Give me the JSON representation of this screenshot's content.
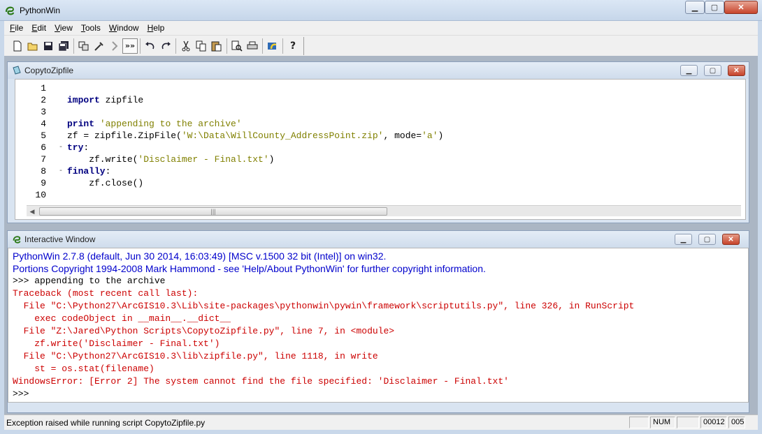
{
  "window": {
    "title": "PythonWin",
    "min_label": "▁",
    "max_label": "▢",
    "close_label": "✕"
  },
  "menu": [
    "File",
    "Edit",
    "View",
    "Tools",
    "Window",
    "Help"
  ],
  "editor": {
    "title": "CopytoZipfile",
    "scroll_thumb": "|||",
    "lines": [
      {
        "num": "1",
        "fold": "",
        "html": ""
      },
      {
        "num": "2",
        "fold": "",
        "parts": [
          [
            "kw",
            "import"
          ],
          [
            "",
            " zipfile"
          ]
        ]
      },
      {
        "num": "3",
        "fold": "",
        "parts": []
      },
      {
        "num": "4",
        "fold": "",
        "parts": [
          [
            "kw",
            "print"
          ],
          [
            "",
            " "
          ],
          [
            "str",
            "'appending to the archive'"
          ]
        ]
      },
      {
        "num": "5",
        "fold": "",
        "parts": [
          [
            "",
            "zf = zipfile.ZipFile("
          ],
          [
            "str",
            "'W:\\Data\\WillCounty_AddressPoint.zip'"
          ],
          [
            "",
            ", mode="
          ],
          [
            "str",
            "'a'"
          ],
          [
            "",
            ")"
          ]
        ]
      },
      {
        "num": "6",
        "fold": "-",
        "parts": [
          [
            "kw",
            "try"
          ],
          [
            "",
            ":"
          ]
        ]
      },
      {
        "num": "7",
        "fold": "",
        "parts": [
          [
            "",
            "    zf.write("
          ],
          [
            "str",
            "'Disclaimer - Final.txt'"
          ],
          [
            "",
            ")"
          ]
        ]
      },
      {
        "num": "8",
        "fold": "-",
        "parts": [
          [
            "kw",
            "finally"
          ],
          [
            "",
            ":"
          ]
        ]
      },
      {
        "num": "9",
        "fold": "",
        "parts": [
          [
            "",
            "    zf.close()"
          ]
        ]
      },
      {
        "num": "10",
        "fold": "",
        "parts": []
      }
    ]
  },
  "interactive": {
    "title": "Interactive Window",
    "banner": [
      "PythonWin 2.7.8 (default, Jun 30 2014, 16:03:49) [MSC v.1500 32 bit (Intel)] on win32.",
      "Portions Copyright 1994-2008 Mark Hammond - see 'Help/About PythonWin' for further copyright information."
    ],
    "output": [
      {
        "color": "black",
        "text": ">>> appending to the archive"
      },
      {
        "color": "red",
        "text": "Traceback (most recent call last):"
      },
      {
        "color": "red",
        "text": "  File \"C:\\Python27\\ArcGIS10.3\\Lib\\site-packages\\pythonwin\\pywin\\framework\\scriptutils.py\", line 326, in RunScript"
      },
      {
        "color": "red",
        "text": "    exec codeObject in __main__.__dict__"
      },
      {
        "color": "red",
        "text": "  File \"Z:\\Jared\\Python Scripts\\CopytoZipfile.py\", line 7, in <module>"
      },
      {
        "color": "red",
        "text": "    zf.write('Disclaimer - Final.txt')"
      },
      {
        "color": "red",
        "text": "  File \"C:\\Python27\\ArcGIS10.3\\lib\\zipfile.py\", line 1118, in write"
      },
      {
        "color": "red",
        "text": "    st = os.stat(filename)"
      },
      {
        "color": "red",
        "text": "WindowsError: [Error 2] The system cannot find the file specified: 'Disclaimer - Final.txt'"
      },
      {
        "color": "black",
        "text": ">>>"
      }
    ]
  },
  "status": {
    "message": "Exception raised while running script  CopytoZipfile.py",
    "num": "NUM",
    "line": "00012",
    "col": "005"
  }
}
